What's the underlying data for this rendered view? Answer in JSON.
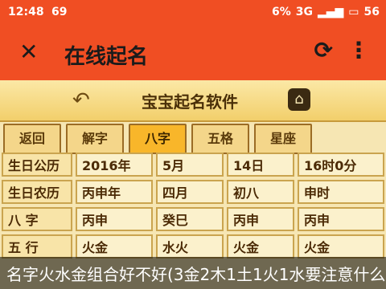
{
  "status_bar": {
    "time": "12:48",
    "extra": "69",
    "battery_percent_text": "6%",
    "signal_text": "3G",
    "battery_value": "56"
  },
  "app_bar": {
    "title": "在线起名"
  },
  "header": {
    "name": "宝宝起名软件"
  },
  "tabs": [
    "返回",
    "解字",
    "八字",
    "五格",
    "星座"
  ],
  "table": {
    "rows": [
      [
        "生日公历",
        "2016年",
        "5月",
        "14日",
        "16时0分"
      ],
      [
        "生日农历",
        "丙申年",
        "四月",
        "初八",
        "申时"
      ],
      [
        "八 字",
        "丙申",
        "癸巳",
        "丙申",
        "丙申"
      ],
      [
        "五 行",
        "火金",
        "水火",
        "火金",
        "火金"
      ]
    ]
  },
  "caption": "名字火水金组合好不好(3金2木1土1火1水要注意什么)",
  "colors": {
    "appbar": "#f04e23",
    "header_bg": "#f2cf6b",
    "active_tab": "#f8b62a"
  },
  "icons": {
    "close": "close-icon",
    "refresh": "refresh-icon",
    "more": "more-icon",
    "back": "back-arrow-icon",
    "logo": "app-logo-icon"
  }
}
